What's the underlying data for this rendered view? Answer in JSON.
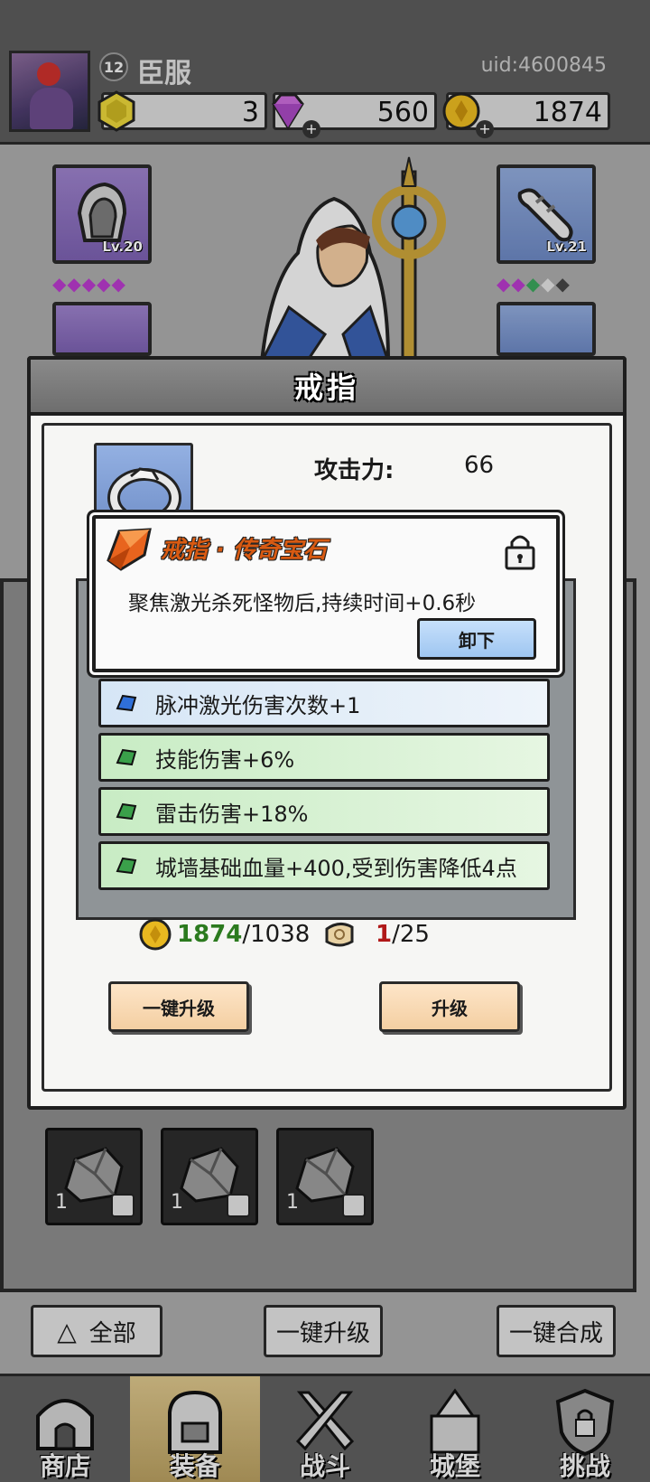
{
  "header": {
    "level": "12",
    "player_name": "臣服",
    "uid": "uid:4600845",
    "resources": [
      {
        "icon": "hexagon-gem-icon",
        "value": "3"
      },
      {
        "icon": "diamond-icon",
        "value": "560"
      },
      {
        "icon": "gold-coin-icon",
        "value": "1874"
      }
    ]
  },
  "equipment": {
    "left_top_level": "Lv.20",
    "right_top_level": "Lv.21",
    "left_diamonds": "◆◆◆◆◆",
    "right_diamonds": "◆◆◆◆◆"
  },
  "modal": {
    "title": "戒指",
    "stat_label": "攻击力:",
    "stat_value": "66",
    "gem_effects": [
      {
        "rarity": "blue",
        "text": "脉冲激光伤害次数+1"
      },
      {
        "rarity": "green",
        "text": "技能伤害+6%"
      },
      {
        "rarity": "green",
        "text": "雷击伤害+18%"
      },
      {
        "rarity": "green",
        "text": "城墙基础血量+400,受到伤害降低4点"
      }
    ],
    "gold_cost": {
      "have": "1874",
      "need": "/1038"
    },
    "scroll_cost": {
      "have": "1",
      "need": "/25"
    },
    "btn_auto_upgrade": "一键升级",
    "btn_upgrade": "升级"
  },
  "tooltip": {
    "title": "戒指 · 传奇宝石",
    "description": "聚焦激光杀死怪物后,持续时间+0.6秒",
    "unequip_label": "卸下"
  },
  "inventory": {
    "items": [
      {
        "count": "1"
      },
      {
        "count": "1"
      },
      {
        "count": "1"
      }
    ]
  },
  "bottom_actions": {
    "filter_all": "全部",
    "auto_upgrade": "一键升级",
    "auto_merge": "一键合成"
  },
  "tabs": [
    {
      "label": "商店",
      "active": false
    },
    {
      "label": "装备",
      "active": true
    },
    {
      "label": "战斗",
      "active": false
    },
    {
      "label": "城堡",
      "active": false
    },
    {
      "label": "挑战",
      "active": false
    }
  ],
  "colors": {
    "legendary_orange": "#d85a12",
    "rarity_blue": "#d6e6f6",
    "rarity_green": "#c8ecc4",
    "cost_ok": "#2b7a1e",
    "cost_insufficient": "#b01818",
    "button_peach": "#f4cfa2",
    "button_blue": "#9fc6f1"
  }
}
